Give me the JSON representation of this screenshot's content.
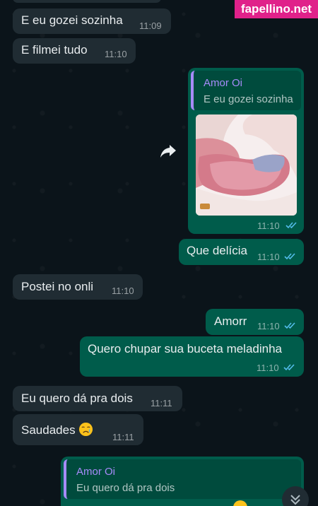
{
  "watermark": "fapellino.net",
  "messages": [
    {
      "text": "E eu gozei sozinha",
      "time": "11:09"
    },
    {
      "text": "E filmei tudo",
      "time": "11:10"
    },
    {
      "reply_author": "Amor Oi",
      "reply_text": "E eu gozei sozinha",
      "time": "11:10"
    },
    {
      "text": "Que delícia",
      "time": "11:10"
    },
    {
      "text": "Postei no onli",
      "time": "11:10"
    },
    {
      "text": "Amorr",
      "time": "11:10"
    },
    {
      "text": "Quero chupar sua buceta meladinha",
      "time": "11:10"
    },
    {
      "text": "Eu quero dá pra dois",
      "time": "11:11"
    },
    {
      "text": "Saudades",
      "time": "11:11"
    },
    {
      "reply_author": "Amor Oi",
      "reply_text": "Eu quero dá pra dois"
    }
  ],
  "colors": {
    "background": "#0b141a",
    "incoming_bubble": "#202c33",
    "outgoing_bubble": "#005c4b",
    "read_ticks": "#53bdeb",
    "quote_accent": "#a78bfa",
    "watermark": "#e0218a"
  },
  "icons": {
    "forward": "forward-icon",
    "read_receipt": "double-check-icon",
    "scroll_down": "chevron-double-down-icon",
    "emoji": "crying-face-emoji"
  }
}
